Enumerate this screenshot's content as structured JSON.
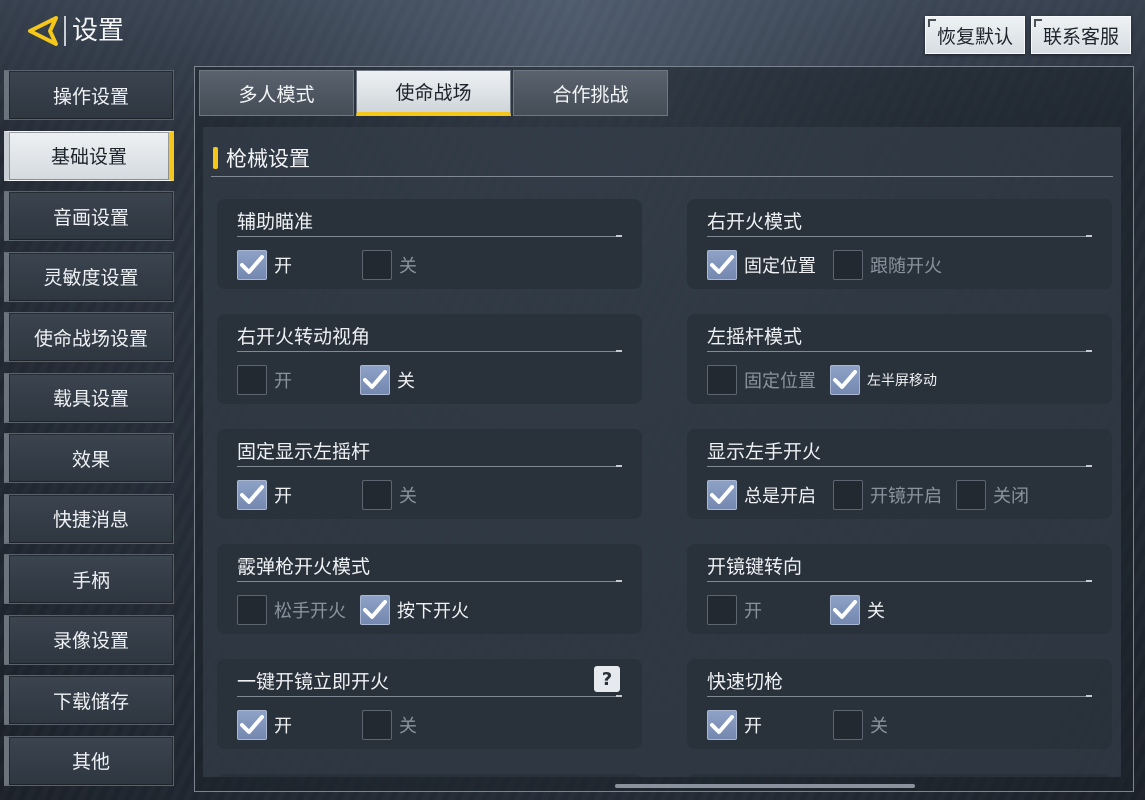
{
  "header": {
    "title": "设置",
    "restore_label": "恢复默认",
    "contact_label": "联系客服"
  },
  "sidebar": {
    "items": [
      {
        "label": "操作设置",
        "active": false
      },
      {
        "label": "基础设置",
        "active": true
      },
      {
        "label": "音画设置",
        "active": false
      },
      {
        "label": "灵敏度设置",
        "active": false
      },
      {
        "label": "使命战场设置",
        "active": false
      },
      {
        "label": "载具设置",
        "active": false
      },
      {
        "label": "效果",
        "active": false
      },
      {
        "label": "快捷消息",
        "active": false
      },
      {
        "label": "手柄",
        "active": false
      },
      {
        "label": "录像设置",
        "active": false
      },
      {
        "label": "下载储存",
        "active": false
      },
      {
        "label": "其他",
        "active": false
      }
    ]
  },
  "tabs": [
    {
      "label": "多人模式",
      "active": false
    },
    {
      "label": "使命战场",
      "active": true
    },
    {
      "label": "合作挑战",
      "active": false
    }
  ],
  "section": {
    "title": "枪械设置"
  },
  "settings": [
    {
      "label": "辅助瞄准",
      "options": [
        {
          "text": "开",
          "checked": true
        },
        {
          "text": "关",
          "checked": false
        }
      ]
    },
    {
      "label": "右开火模式",
      "options": [
        {
          "text": "固定位置",
          "checked": true
        },
        {
          "text": "跟随开火",
          "checked": false
        }
      ]
    },
    {
      "label": "右开火转动视角",
      "options": [
        {
          "text": "开",
          "checked": false
        },
        {
          "text": "关",
          "checked": true
        }
      ]
    },
    {
      "label": "左摇杆模式",
      "options": [
        {
          "text": "固定位置",
          "checked": false
        },
        {
          "text": "左半屏移动",
          "checked": true
        }
      ]
    },
    {
      "label": "固定显示左摇杆",
      "options": [
        {
          "text": "开",
          "checked": true
        },
        {
          "text": "关",
          "checked": false
        }
      ]
    },
    {
      "label": "显示左手开火",
      "options": [
        {
          "text": "总是开启",
          "checked": true
        },
        {
          "text": "开镜开启",
          "checked": false
        },
        {
          "text": "关闭",
          "checked": false
        }
      ]
    },
    {
      "label": "霰弹枪开火模式",
      "options": [
        {
          "text": "松手开火",
          "checked": false
        },
        {
          "text": "按下开火",
          "checked": true
        }
      ]
    },
    {
      "label": "开镜键转向",
      "options": [
        {
          "text": "开",
          "checked": false
        },
        {
          "text": "关",
          "checked": true
        }
      ]
    },
    {
      "label": "一键开镜立即开火",
      "help": "?",
      "options": [
        {
          "text": "开",
          "checked": true
        },
        {
          "text": "关",
          "checked": false
        }
      ]
    },
    {
      "label": "快速切枪",
      "options": [
        {
          "text": "开",
          "checked": true
        },
        {
          "text": "关",
          "checked": false
        }
      ]
    }
  ],
  "icons": {
    "back": "back-arrow-icon",
    "check": "check-icon",
    "help": "help-icon"
  },
  "colors": {
    "accent": "#f4c71a",
    "checked": "#8ea1c6"
  }
}
